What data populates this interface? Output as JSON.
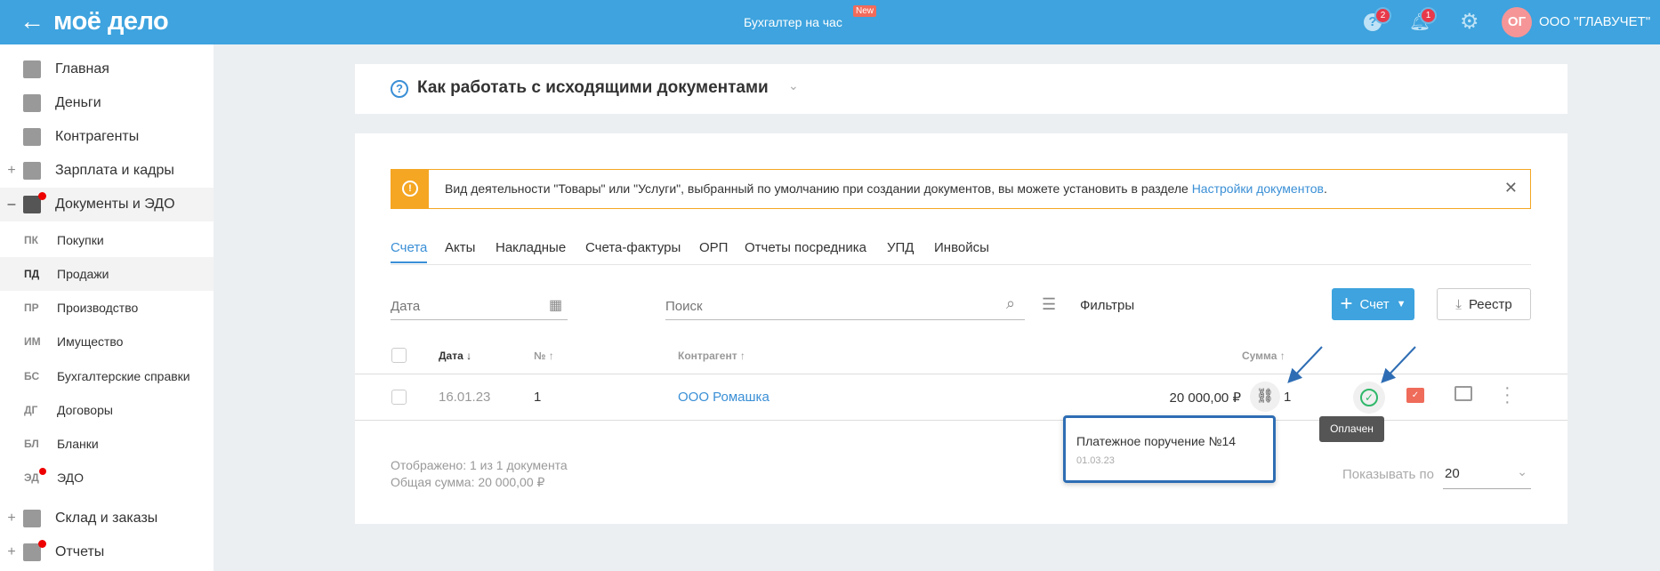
{
  "header": {
    "logo": "моё дело",
    "center": "Бухгалтер на час",
    "new_badge": "New",
    "help_count": "2",
    "notif_count": "1",
    "avatar": "ОГ",
    "org": "ООО \"ГЛАВУЧЕТ\""
  },
  "sidebar": {
    "items": [
      {
        "label": "Главная",
        "icon": "home-icon"
      },
      {
        "label": "Деньги",
        "icon": "money-icon"
      },
      {
        "label": "Контрагенты",
        "icon": "contractor-icon"
      },
      {
        "label": "Зарплата и кадры",
        "icon": "wallet-icon",
        "prefix": "+"
      },
      {
        "label": "Документы и ЭДО",
        "icon": "folder-icon",
        "prefix": "–"
      }
    ],
    "sub": [
      {
        "abbr": "ПК",
        "label": "Покупки"
      },
      {
        "abbr": "ПД",
        "label": "Продажи"
      },
      {
        "abbr": "ПР",
        "label": "Производство"
      },
      {
        "abbr": "ИМ",
        "label": "Имущество"
      },
      {
        "abbr": "БС",
        "label": "Бухгалтерские справки"
      },
      {
        "abbr": "ДГ",
        "label": "Договоры"
      },
      {
        "abbr": "БЛ",
        "label": "Бланки"
      },
      {
        "abbr": "ЭД",
        "label": "ЭДО"
      }
    ],
    "bottom": [
      {
        "label": "Склад и заказы",
        "prefix": "+"
      },
      {
        "label": "Отчеты",
        "prefix": "+"
      }
    ]
  },
  "help": {
    "title": "Как работать с исходящими документами"
  },
  "banner": {
    "text": "Вид деятельности \"Товары\" или \"Услуги\", выбранный по умолчанию при создании документов, вы можете установить в разделе ",
    "link": "Настройки документов",
    "end": "."
  },
  "tabs": [
    "Счета",
    "Акты",
    "Накладные",
    "Счета-фактуры",
    "ОРП",
    "Отчеты посредника",
    "УПД",
    "Инвойсы"
  ],
  "toolbar": {
    "date_placeholder": "Дата",
    "search_placeholder": "Поиск",
    "filters": "Фильтры",
    "new_invoice": "Счет",
    "registry": "Реестр"
  },
  "table": {
    "headers": {
      "date": "Дата ↓",
      "num": "№ ↑",
      "contractor": "Контрагент ↑",
      "sum": "Сумма ↑"
    },
    "rows": [
      {
        "date": "16.01.23",
        "num": "1",
        "contractor": "ООО Ромашка",
        "sum": "20 000,00 ₽",
        "links": "1"
      }
    ]
  },
  "popup": {
    "title": "Платежное поручение №14",
    "date": "01.03.23"
  },
  "tooltip": "Оплачен",
  "footer": {
    "shown": "Отображено: 1 из 1 документа",
    "total": "Общая сумма: 20 000,00 ₽",
    "per_page_label": "Показывать по",
    "per_page": "20"
  },
  "colors": {
    "header": "#3ea3de",
    "link": "#3a8fd6",
    "paid": "#2fb86a",
    "warning": "#f5a623"
  }
}
